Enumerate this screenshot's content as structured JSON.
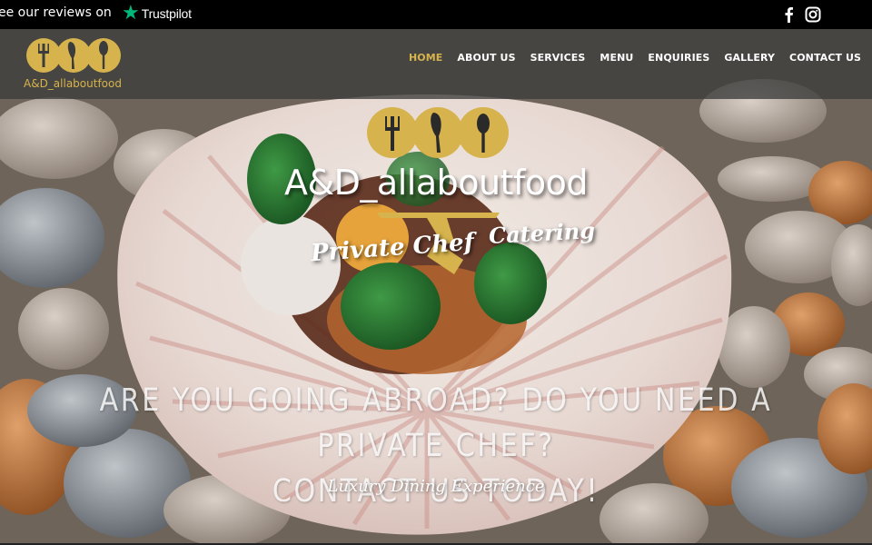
{
  "topbar": {
    "review_text": "ee our reviews on",
    "trustpilot_label": "Trustpilot",
    "trustpilot_color": "#00b67a",
    "social": [
      {
        "icon": "facebook-icon"
      },
      {
        "icon": "instagram-icon"
      }
    ]
  },
  "nav": {
    "brand": "A&D_allaboutfood",
    "accent_color": "#d6b34c",
    "items": [
      {
        "label": "HOME",
        "active": true
      },
      {
        "label": "ABOUT US"
      },
      {
        "label": "SERVICES"
      },
      {
        "label": "MENU"
      },
      {
        "label": "ENQUIRIES"
      },
      {
        "label": "GALLERY"
      },
      {
        "label": "CONTACT US"
      }
    ]
  },
  "hero": {
    "brand": "A&D_allaboutfood",
    "script_left": "Private Chef",
    "script_right": "Catering",
    "headline_line1": "ARE YOU GOING ABROAD? DO YOU NEED A PRIVATE CHEF?",
    "headline_line2": "CONTACT US TODAY!",
    "tagline": "Luxury Dining Experience",
    "background": "scallop-shell-on-pebbles-photo"
  }
}
